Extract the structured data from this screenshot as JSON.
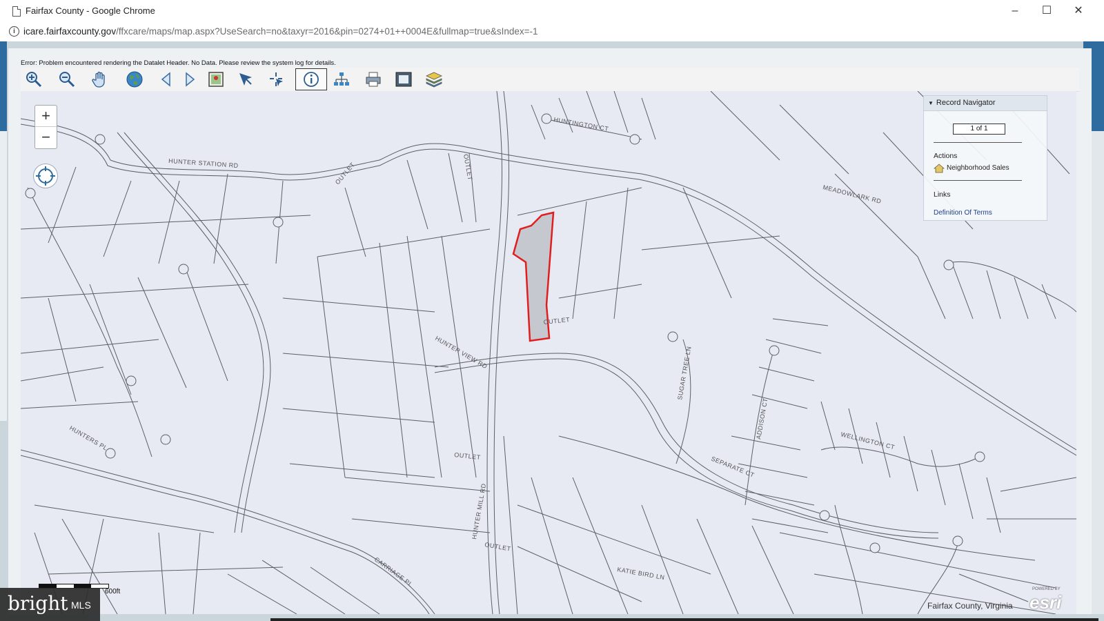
{
  "window": {
    "title": "Fairfax County - Google Chrome",
    "minimize": "–",
    "maximize": "☐",
    "close": "✕"
  },
  "address": {
    "host": "icare.fairfaxcounty.gov",
    "path": "/ffxcare/maps/map.aspx?UseSearch=no&taxyr=2016&pin=0274+01++0004E&fullmap=true&sIndex=-1"
  },
  "error_message": "Error: Problem encountered rendering the Datalet Header. No Data. Please review the system log for details.",
  "toolbar": {
    "tools": [
      "zoom-in-icon",
      "zoom-out-icon",
      "pan-hand-icon",
      "full-extent-globe-icon",
      "previous-extent-icon",
      "next-extent-icon",
      "map-extent-icon",
      "select-arrow-icon",
      "select-point-icon",
      "identify-info-icon",
      "network-icon",
      "print-icon",
      "fit-screen-icon",
      "layers-icon"
    ]
  },
  "map_controls": {
    "zoom_in": "+",
    "zoom_out": "−"
  },
  "record_navigator": {
    "title": "Record Navigator",
    "count": "1 of 1",
    "actions_label": "Actions",
    "action_item": "Neighborhood Sales",
    "links_label": "Links",
    "link_item": "Definition Of Terms"
  },
  "streets": {
    "hunter_station": "HUNTER STATION RD",
    "hunter_view": "HUNTER VIEW RD",
    "hunter_mill": "HUNTER MILL RD",
    "meadowlark": "MEADOWLARK RD",
    "huntington": "HUNTINGTON CT",
    "outlet1": "OUTLET",
    "outlet2": "OUTLET",
    "outlet3": "OUTLET",
    "outlet4": "OUTLET",
    "outlet5": "OUTLET",
    "hunters_pl": "HUNTERS PL",
    "katie_bird": "KATIE BIRD LN",
    "carriagepath": "CARRIAGE PL",
    "sugar_tree": "SUGAR TREE LN",
    "wellington": "WELLINGTON CT",
    "separate_ct": "SEPARATE CT",
    "addison": "ADDISON CT"
  },
  "scale": "600ft",
  "county_label": "Fairfax County, Virginia",
  "esri_powered": "POWERED BY",
  "esri": "esri",
  "watermark": {
    "brand": "bright",
    "suffix": "MLS"
  }
}
